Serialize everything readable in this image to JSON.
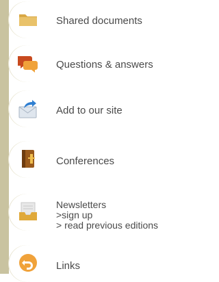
{
  "menu": {
    "items": [
      {
        "label": "Shared documents",
        "icon": "folder-icon"
      },
      {
        "label": "Questions & answers",
        "icon": "speech-bubbles-icon"
      },
      {
        "label": "Add to our site",
        "icon": "envelope-arrow-icon"
      },
      {
        "label": "Conferences",
        "icon": "notebook-icon"
      },
      {
        "label": "Newsletters",
        "icon": "inbox-tray-icon",
        "links": [
          ">sign up",
          "> read previous editions"
        ]
      },
      {
        "label": "Links",
        "icon": "back-arrow-icon"
      }
    ]
  },
  "colors": {
    "rail": "#c9c3a0",
    "text": "#4a4a4a",
    "folder": "#e4b95a",
    "bubble_back": "#c84a1e",
    "bubble_front": "#f0a23a",
    "envelope": "#dfe6ee",
    "arrow": "#2f7fd1",
    "notebook": "#9a5a1c",
    "tray": "#e0a93a",
    "links_circle": "#f0a23a"
  }
}
